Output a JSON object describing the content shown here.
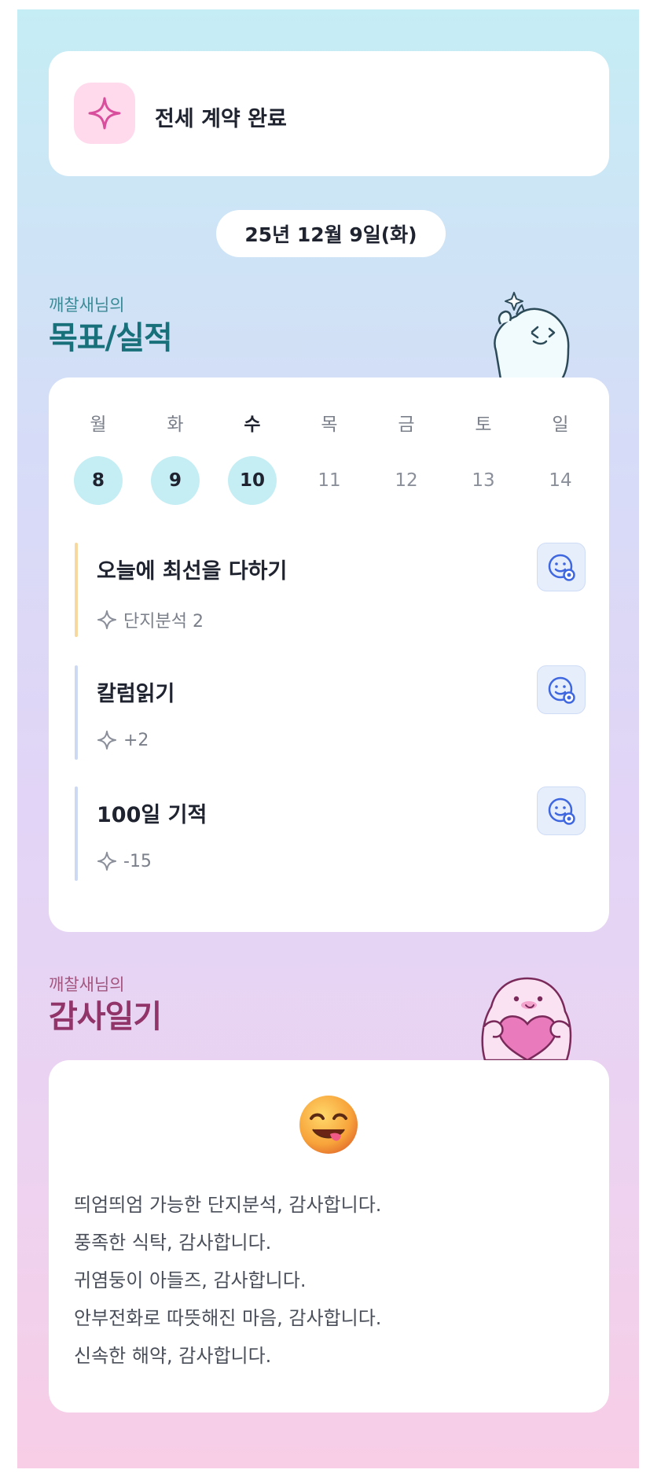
{
  "notice": {
    "title": "전세 계약 완료",
    "icon": "sparkle-icon"
  },
  "date": "25년 12월 9일(화)",
  "goals_section": {
    "owner": "깨찰새님의",
    "title": "목표/실적"
  },
  "week": {
    "days": [
      {
        "label": "월",
        "num": "8",
        "done": true
      },
      {
        "label": "화",
        "num": "9",
        "done": true
      },
      {
        "label": "수",
        "num": "10",
        "done": true,
        "today": true
      },
      {
        "label": "목",
        "num": "11",
        "done": false
      },
      {
        "label": "금",
        "num": "12",
        "done": false
      },
      {
        "label": "토",
        "num": "13",
        "done": false
      },
      {
        "label": "일",
        "num": "14",
        "done": false
      }
    ]
  },
  "goals": [
    {
      "title": "오늘에 최선을 다하기",
      "meta": "단지분석 2",
      "bar_color": "#f7d9a0"
    },
    {
      "title": "칼럼읽기",
      "meta": "+2",
      "bar_color": "#cdd8f3"
    },
    {
      "title": "100일 기적",
      "meta": "-15",
      "bar_color": "#cdd8f3"
    }
  ],
  "gratitude_section": {
    "owner": "깨찰새님의",
    "title": "감사일기"
  },
  "gratitude": {
    "emoji": "smiling-face-emoji",
    "lines": [
      "띄엄띄엄 가능한 단지분석, 감사합니다.",
      "풍족한 식탁, 감사합니다.",
      "귀염둥이 아들즈, 감사합니다.",
      "안부전화로 따뜻해진 마음, 감사합니다.",
      "신속한 해약, 감사합니다."
    ]
  },
  "colors": {
    "accent_teal": "#17707a",
    "accent_plum": "#91346a",
    "done_circle": "#c4eef4",
    "smile_button": "#3f67e0"
  }
}
